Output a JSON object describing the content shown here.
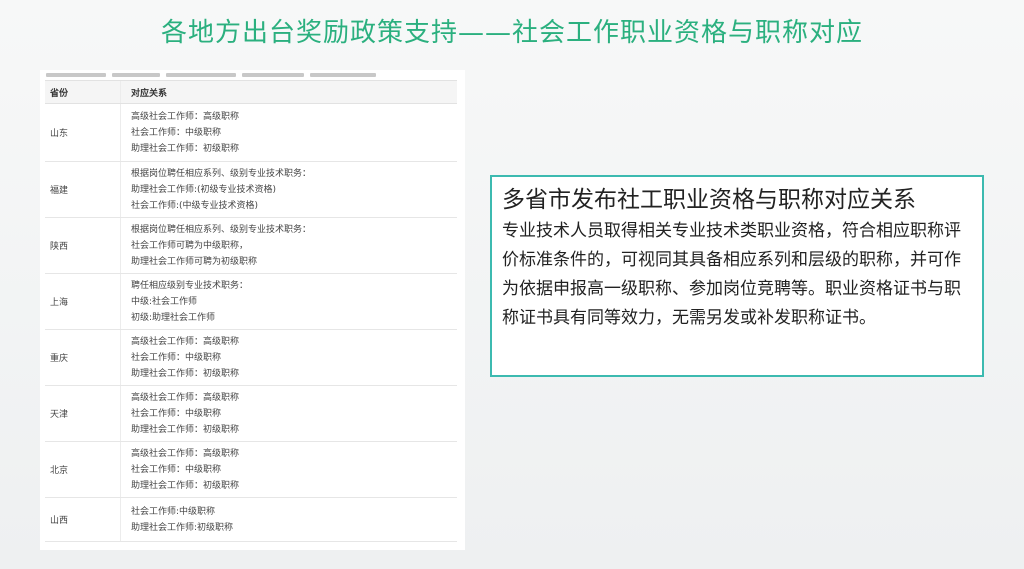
{
  "slide": {
    "title": "各地方出台奖励政策支持——社会工作职业资格与职称对应"
  },
  "table": {
    "headers": {
      "province": "省份",
      "relation": "对应关系"
    },
    "rows": [
      {
        "province": "山东",
        "lines": [
          "高级社会工作师：高级职称",
          "社会工作师：中级职称",
          "助理社会工作师：初级职称"
        ]
      },
      {
        "province": "福建",
        "lines": [
          "根据岗位聘任相应系列、级别专业技术职务：",
          "助理社会工作师:(初级专业技术资格)",
          "社会工作师:(中级专业技术资格)"
        ]
      },
      {
        "province": "陕西",
        "lines": [
          "根据岗位聘任相应系列、级别专业技术职务：",
          "社会工作师可聘为中级职称，",
          "助理社会工作师可聘为初级职称"
        ]
      },
      {
        "province": "上海",
        "lines": [
          "聘任相应级别专业技术职务：",
          "中级:社会工作师",
          "初级:助理社会工作师"
        ]
      },
      {
        "province": "重庆",
        "lines": [
          "高级社会工作师：高级职称",
          "社会工作师：中级职称",
          "助理社会工作师：初级职称"
        ]
      },
      {
        "province": "天津",
        "lines": [
          "高级社会工作师：高级职称",
          "社会工作师：中级职称",
          "助理社会工作师：初级职称"
        ]
      },
      {
        "province": "北京",
        "lines": [
          "高级社会工作师：高级职称",
          "社会工作师：中级职称",
          "助理社会工作师：初级职称"
        ]
      },
      {
        "province": "山西",
        "lines": [
          "社会工作师:中级职称",
          "助理社会工作师:初级职称"
        ]
      }
    ]
  },
  "info_box": {
    "title": "多省市发布社工职业资格与职称对应关系",
    "body": "专业技术人员取得相关专业技术类职业资格，符合相应职称评价标准条件的，可视同其具备相应系列和层级的职称，并可作为依据申报高一级职称、参加岗位竞聘等。职业资格证书与职称证书具有同等效力，无需另发或补发职称证书。"
  },
  "colors": {
    "title": "#2bb07f",
    "box_border": "#3cbab0"
  }
}
